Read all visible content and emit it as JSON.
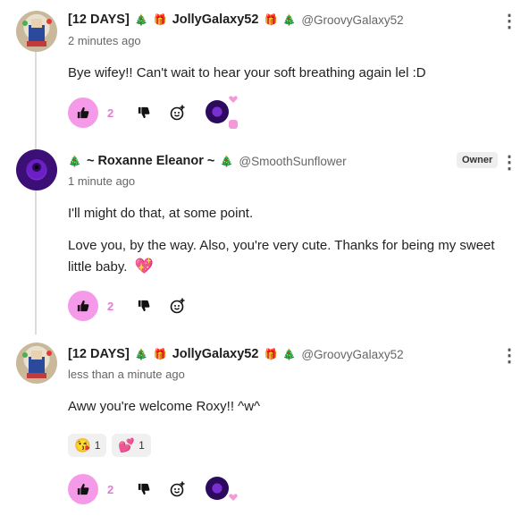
{
  "comments": [
    {
      "author_prefix": "[12 DAYS]",
      "author_name": "JollyGalaxy52",
      "handle": "@GroovyGalaxy52",
      "time": "2 minutes ago",
      "text": "Bye wifey!! Can't wait to hear your soft breathing again lel :D",
      "like_count": "2"
    },
    {
      "author_name": "~ Roxanne Eleanor ~",
      "handle": "@SmoothSunflower",
      "badge": "Owner",
      "time": "1 minute ago",
      "text_line1": "I'll might do that, at some point.",
      "text_line2": "Love you, by the way. Also, you're very cute. Thanks for being my sweet",
      "text_line3": "little baby.",
      "like_count": "2"
    },
    {
      "author_prefix": "[12 DAYS]",
      "author_name": "JollyGalaxy52",
      "handle": "@GroovyGalaxy52",
      "time": "less than a minute ago",
      "text": "Aww you're welcome Roxy!! ^w^",
      "reactions": [
        {
          "emoji": "😘",
          "count": "1"
        },
        {
          "emoji": "💕",
          "count": "1"
        }
      ],
      "like_count": "2"
    }
  ],
  "glyphs": {
    "tree": "🎄",
    "gift": "🎁",
    "heart_sparkle": "💖",
    "menu": "⋮"
  }
}
